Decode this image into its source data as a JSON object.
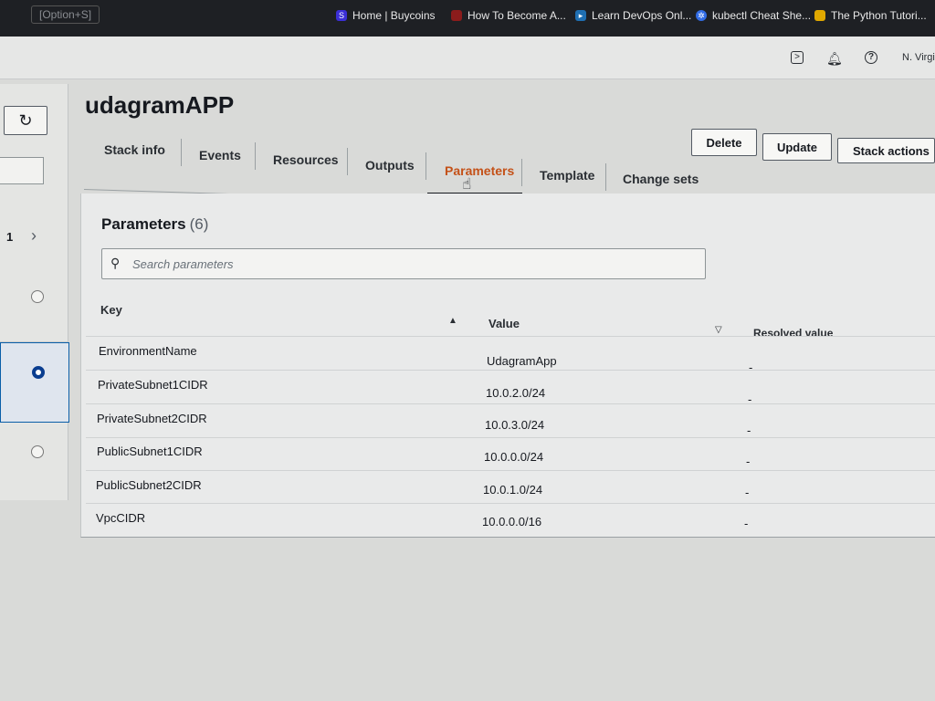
{
  "bookmarks": {
    "hint": "[Option+S]",
    "items": [
      {
        "label": "Home | Buycoins",
        "color": "#3b2fd6"
      },
      {
        "label": "How To Become A...",
        "color": "#8b1c1c"
      },
      {
        "label": "Learn DevOps Onl...",
        "color": "#1f6fb2"
      },
      {
        "label": "kubectl Cheat She...",
        "color": "#326ce5"
      },
      {
        "label": "The Python Tutori...",
        "color": "#e0a800"
      }
    ]
  },
  "console_header": {
    "icons": [
      "cloudshell-icon",
      "bell-icon",
      "help-icon"
    ],
    "region": "N. Virgin"
  },
  "sidebar": {
    "refresh_icon": "↻",
    "count": "1",
    "next_icon": "›"
  },
  "stack": {
    "name": "udagramAPP"
  },
  "tabs": [
    "Stack info",
    "Events",
    "Resources",
    "Outputs",
    "Parameters",
    "Template",
    "Change sets"
  ],
  "active_tab": "Parameters",
  "actions": {
    "delete": "Delete",
    "update": "Update",
    "stack_actions": "Stack actions"
  },
  "parameters": {
    "title": "Parameters",
    "count": "(6)",
    "search_placeholder": "Search parameters",
    "columns": {
      "key": "Key",
      "value": "Value",
      "resolved": "Resolved value"
    },
    "rows": [
      {
        "key": "EnvironmentName",
        "value": "UdagramApp",
        "resolved": "-"
      },
      {
        "key": "PrivateSubnet1CIDR",
        "value": "10.0.2.0/24",
        "resolved": "-"
      },
      {
        "key": "PrivateSubnet2CIDR",
        "value": "10.0.3.0/24",
        "resolved": "-"
      },
      {
        "key": "PublicSubnet1CIDR",
        "value": "10.0.0.0/24",
        "resolved": "-"
      },
      {
        "key": "PublicSubnet2CIDR",
        "value": "10.0.1.0/24",
        "resolved": "-"
      },
      {
        "key": "VpcCIDR",
        "value": "10.0.0.0/16",
        "resolved": "-"
      }
    ]
  }
}
